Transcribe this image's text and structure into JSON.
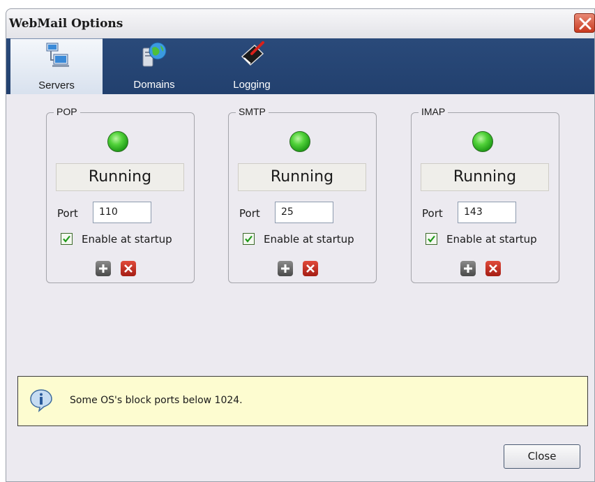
{
  "window": {
    "title": "WebMail Options"
  },
  "tabs": [
    {
      "label": "Servers",
      "icon": "servers-icon",
      "active": true
    },
    {
      "label": "Domains",
      "icon": "domains-globe-icon",
      "active": false
    },
    {
      "label": "Logging",
      "icon": "logging-book-icon",
      "active": false
    }
  ],
  "servers": [
    {
      "name": "POP",
      "status": "Running",
      "port_label": "Port",
      "port": "110",
      "startup_label": "Enable at startup",
      "enabled": true,
      "led_color": "#2fbf22"
    },
    {
      "name": "SMTP",
      "status": "Running",
      "port_label": "Port",
      "port": "25",
      "startup_label": "Enable at startup",
      "enabled": true,
      "led_color": "#2fbf22"
    },
    {
      "name": "IMAP",
      "status": "Running",
      "port_label": "Port",
      "port": "143",
      "startup_label": "Enable at startup",
      "enabled": true,
      "led_color": "#2fbf22"
    }
  ],
  "info": {
    "icon": "info-icon",
    "text": "Some OS's block ports below 1024."
  },
  "buttons": {
    "close": "Close"
  },
  "colors": {
    "toolbar": "#22406e",
    "info_background": "#fdfcd0",
    "close_title_button": "#c9391f"
  }
}
